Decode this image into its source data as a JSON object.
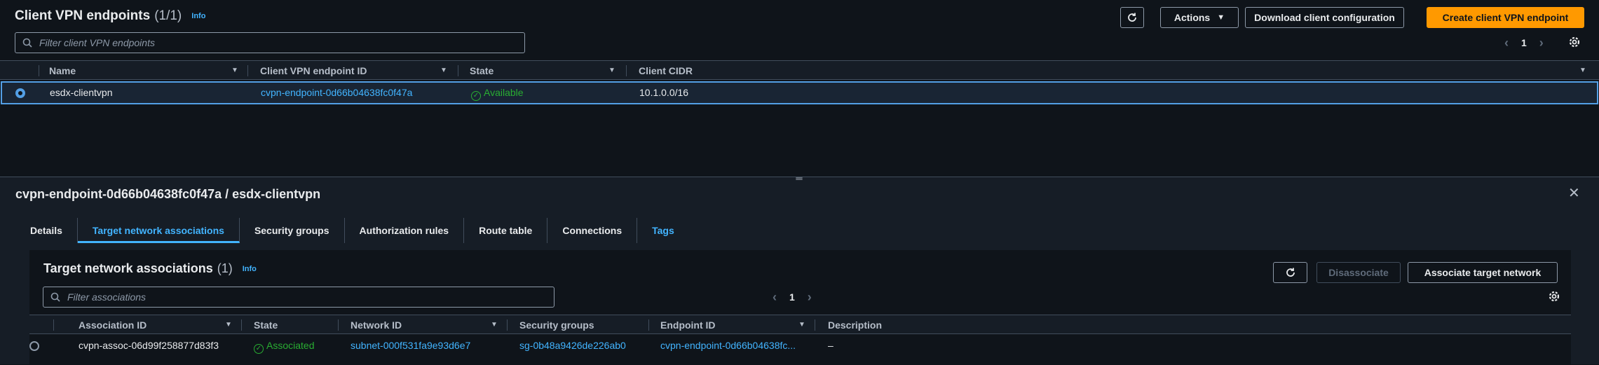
{
  "header": {
    "title": "Client VPN endpoints",
    "count": "(1/1)",
    "info": "Info",
    "refresh_icon": "refresh-icon",
    "actions_label": "Actions",
    "download_label": "Download client configuration",
    "create_label": "Create client VPN endpoint"
  },
  "search": {
    "placeholder": "Filter client VPN endpoints"
  },
  "pager": {
    "page": "1"
  },
  "table": {
    "columns": [
      "Name",
      "Client VPN endpoint ID",
      "State",
      "Client CIDR"
    ],
    "rows": [
      {
        "name": "esdx-clientvpn",
        "endpoint_id": "cvpn-endpoint-0d66b04638fc0f47a",
        "state": "Available",
        "cidr": "10.1.0.0/16"
      }
    ]
  },
  "panel": {
    "title": "cvpn-endpoint-0d66b04638fc0f47a / esdx-clientvpn",
    "tabs": [
      "Details",
      "Target network associations",
      "Security groups",
      "Authorization rules",
      "Route table",
      "Connections",
      "Tags"
    ],
    "active_tab": "Target network associations"
  },
  "assoc": {
    "title": "Target network associations",
    "count": "(1)",
    "info": "Info",
    "disassociate_label": "Disassociate",
    "associate_label": "Associate target network",
    "search_placeholder": "Filter associations",
    "page": "1",
    "columns": [
      "Association ID",
      "State",
      "Network ID",
      "Security groups",
      "Endpoint ID",
      "Description"
    ],
    "rows": [
      {
        "association_id": "cvpn-assoc-06d99f258877d83f3",
        "state": "Associated",
        "network_id": "subnet-000f531fa9e93d6e7",
        "security_groups": "sg-0b48a9426de226ab0",
        "endpoint_id": "cvpn-endpoint-0d66b04638fc...",
        "description": "–"
      }
    ]
  },
  "colors": {
    "accent": "#42b4ff",
    "primary": "#ff9900",
    "success": "#29ad32",
    "selected_border": "#539fe5"
  }
}
